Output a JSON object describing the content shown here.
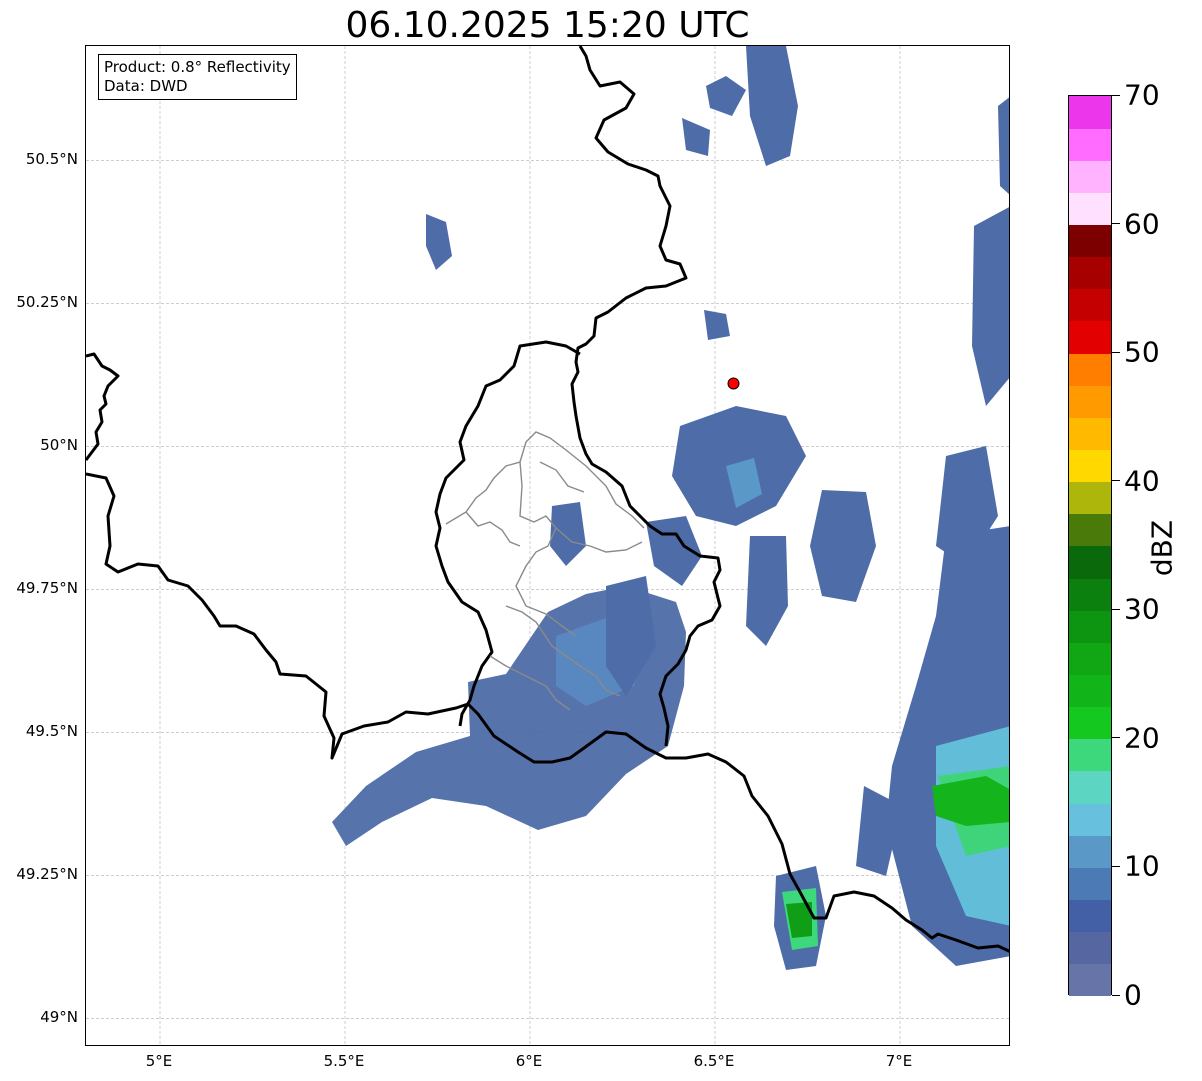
{
  "title": "06.10.2025 15:20 UTC",
  "annotation": {
    "product": "Product: 0.8° Reflectivity",
    "source": "Data: DWD"
  },
  "axes": {
    "x_ticks": [
      {
        "value": 5.0,
        "label": "5°E"
      },
      {
        "value": 5.5,
        "label": "5.5°E"
      },
      {
        "value": 6.0,
        "label": "6°E"
      },
      {
        "value": 6.5,
        "label": "6.5°E"
      },
      {
        "value": 7.0,
        "label": "7°E"
      }
    ],
    "y_ticks": [
      {
        "value": 50.5,
        "label": "50.5°N"
      },
      {
        "value": 50.25,
        "label": "50.25°N"
      },
      {
        "value": 50.0,
        "label": "50°N"
      },
      {
        "value": 49.75,
        "label": "49.75°N"
      },
      {
        "value": 49.5,
        "label": "49.5°N"
      },
      {
        "value": 49.25,
        "label": "49.25°N"
      },
      {
        "value": 49.0,
        "label": "49°N"
      }
    ],
    "lon_range": [
      4.8,
      7.3
    ],
    "lat_range": [
      48.95,
      50.7
    ],
    "grid": true
  },
  "radar_site": {
    "lon": 6.55,
    "lat": 50.11,
    "color": "#ff0000"
  },
  "colorbar": {
    "label": "dBZ",
    "min": 0,
    "max": 70,
    "ticks": [
      "0",
      "10",
      "20",
      "30",
      "40",
      "50",
      "60",
      "70"
    ],
    "colors": [
      "#6674a8",
      "#5566a0",
      "#435fa5",
      "#4b7ab4",
      "#5a98c8",
      "#66c0de",
      "#5cd6c3",
      "#3dd77c",
      "#14c820",
      "#11b51a",
      "#10a614",
      "#0d9411",
      "#0b800f",
      "#09690b",
      "#497a0a",
      "#adb60a",
      "#ffd800",
      "#ffba00",
      "#ff9b00",
      "#ff7e00",
      "#e20000",
      "#c50000",
      "#a60000",
      "#7d0000",
      "#ffe0ff",
      "#ffb3ff",
      "#ff6cff",
      "#ec36ec"
    ]
  },
  "icons": {
    "radar_site": "red-dot-icon"
  }
}
